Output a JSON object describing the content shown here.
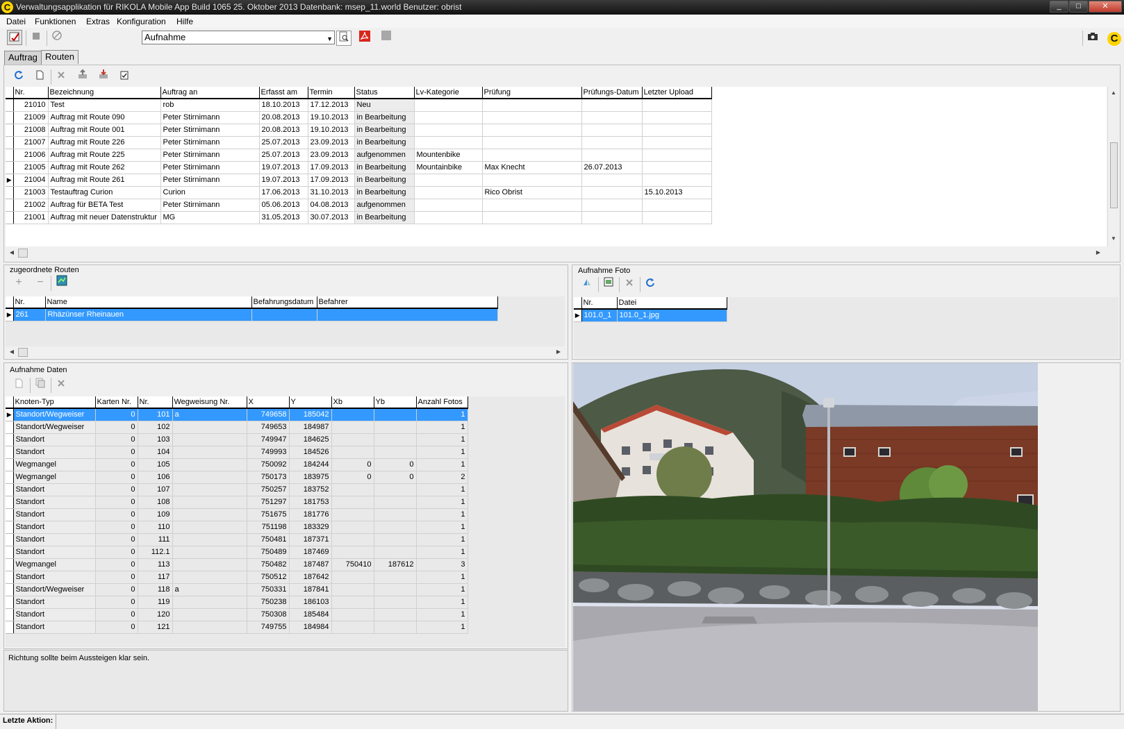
{
  "titlebar": {
    "text": "Verwaltungsapplikation für RIKOLA Mobile App    Build 1065 25. Oktober 2013     Datenbank: msep_11.world     Benutzer: obrist",
    "app_icon": "C",
    "btn_min": "_",
    "btn_max": "□",
    "btn_close": "✕"
  },
  "menu": [
    "Datei",
    "Funktionen",
    "Extras",
    "Konfiguration",
    "Hilfe"
  ],
  "toolbar": {
    "combo_value": "Aufnahme",
    "brand_icon": "C"
  },
  "tabs": [
    "Auftrag",
    "Routen"
  ],
  "orders": {
    "columns": [
      "Nr.",
      "Bezeichnung",
      "Auftrag an",
      "Erfasst am",
      "Termin",
      "Status",
      "Lv-Kategorie",
      "Prüfung",
      "Prüfungs-Datum",
      "Letzter Upload"
    ],
    "rows": [
      [
        "21010",
        "Test",
        "rob",
        "18.10.2013",
        "17.12.2013",
        "Neu",
        "",
        "",
        "",
        ""
      ],
      [
        "21009",
        "Auftrag mit Route 090",
        "Peter Stirnimann",
        "20.08.2013",
        "19.10.2013",
        "in Bearbeitung",
        "",
        "",
        "",
        ""
      ],
      [
        "21008",
        "Auftrag mit Route 001",
        "Peter Stirnimann",
        "20.08.2013",
        "19.10.2013",
        "in Bearbeitung",
        "",
        "",
        "",
        ""
      ],
      [
        "21007",
        "Auftrag mit Route 226",
        "Peter Stirnimann",
        "25.07.2013",
        "23.09.2013",
        "in Bearbeitung",
        "",
        "",
        "",
        ""
      ],
      [
        "21006",
        "Auftrag mit Route 225",
        "Peter Stirnimann",
        "25.07.2013",
        "23.09.2013",
        "aufgenommen",
        "Mountenbike",
        "",
        "",
        ""
      ],
      [
        "21005",
        "Auftrag mit Route 262",
        "Peter Stirnimann",
        "19.07.2013",
        "17.09.2013",
        "in Bearbeitung",
        "Mountainbike",
        "Max Knecht",
        "26.07.2013",
        ""
      ],
      [
        "21004",
        "Auftrag mit Route 261",
        "Peter Stirnimann",
        "19.07.2013",
        "17.09.2013",
        "in Bearbeitung",
        "",
        "",
        "",
        ""
      ],
      [
        "21003",
        "Testauftrag Curion",
        "Curion",
        "17.06.2013",
        "31.10.2013",
        "in Bearbeitung",
        "",
        "Rico Obrist",
        "",
        "15.10.2013"
      ],
      [
        "21002",
        "Auftrag für BETA Test",
        "Peter Stirnimann",
        "05.06.2013",
        "04.08.2013",
        "aufgenommen",
        "",
        "",
        "",
        ""
      ],
      [
        "21001",
        "Auftrag mit neuer Datenstruktur",
        "MG",
        "31.05.2013",
        "30.07.2013",
        "in Bearbeitung",
        "",
        "",
        "",
        ""
      ]
    ]
  },
  "routes": {
    "label": "zugeordnete Routen",
    "columns": [
      "Nr.",
      "Name",
      "Befahrungsdatum",
      "Befahrer"
    ],
    "rows": [
      [
        "261",
        "Rhäzünser Rheinauen",
        "",
        ""
      ]
    ]
  },
  "photos": {
    "label": "Aufnahme Foto",
    "columns": [
      "Nr.",
      "Datei"
    ],
    "rows": [
      [
        "101.0_1",
        "101.0_1.jpg"
      ]
    ]
  },
  "nodes": {
    "label": "Aufnahme Daten",
    "columns": [
      "Knoten-Typ",
      "Karten Nr.",
      "Nr.",
      "Wegweisung Nr.",
      "X",
      "Y",
      "Xb",
      "Yb",
      "Anzahl Fotos"
    ],
    "rows": [
      [
        "Standort/Wegweiser",
        "0",
        "101",
        "a",
        "749658",
        "185042",
        "",
        "",
        "1"
      ],
      [
        "Standort/Wegweiser",
        "0",
        "102",
        "",
        "749653",
        "184987",
        "",
        "",
        "1"
      ],
      [
        "Standort",
        "0",
        "103",
        "",
        "749947",
        "184625",
        "",
        "",
        "1"
      ],
      [
        "Standort",
        "0",
        "104",
        "",
        "749993",
        "184526",
        "",
        "",
        "1"
      ],
      [
        "Wegmangel",
        "0",
        "105",
        "",
        "750092",
        "184244",
        "0",
        "0",
        "1"
      ],
      [
        "Wegmangel",
        "0",
        "106",
        "",
        "750173",
        "183975",
        "0",
        "0",
        "2"
      ],
      [
        "Standort",
        "0",
        "107",
        "",
        "750257",
        "183752",
        "",
        "",
        "1"
      ],
      [
        "Standort",
        "0",
        "108",
        "",
        "751297",
        "181753",
        "",
        "",
        "1"
      ],
      [
        "Standort",
        "0",
        "109",
        "",
        "751675",
        "181776",
        "",
        "",
        "1"
      ],
      [
        "Standort",
        "0",
        "110",
        "",
        "751198",
        "183329",
        "",
        "",
        "1"
      ],
      [
        "Standort",
        "0",
        "111",
        "",
        "750481",
        "187371",
        "",
        "",
        "1"
      ],
      [
        "Standort",
        "0",
        "112.1",
        "",
        "750489",
        "187469",
        "",
        "",
        "1"
      ],
      [
        "Wegmangel",
        "0",
        "113",
        "",
        "750482",
        "187487",
        "750410",
        "187612",
        "3"
      ],
      [
        "Standort",
        "0",
        "117",
        "",
        "750512",
        "187642",
        "",
        "",
        "1"
      ],
      [
        "Standort/Wegweiser",
        "0",
        "118",
        "a",
        "750331",
        "187841",
        "",
        "",
        "1"
      ],
      [
        "Standort",
        "0",
        "119",
        "",
        "750238",
        "186103",
        "",
        "",
        "1"
      ],
      [
        "Standort",
        "0",
        "120",
        "",
        "750308",
        "185484",
        "",
        "",
        "1"
      ],
      [
        "Standort",
        "0",
        "121",
        "",
        "749755",
        "184984",
        "",
        "",
        "1"
      ]
    ]
  },
  "comment": "Richtung sollte beim Aussteigen klar sein.",
  "status": {
    "label": "Letzte Aktion:"
  },
  "colors": {
    "selection": "#3399ff",
    "brand": "#ffd400",
    "refresh_icon": "#1f6fd1"
  }
}
